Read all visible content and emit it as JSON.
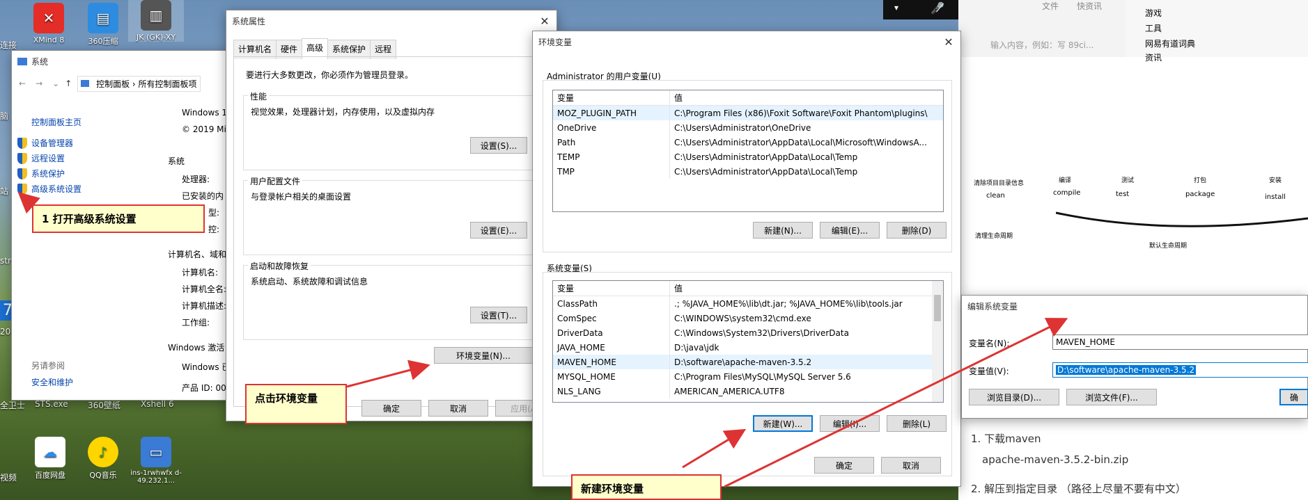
{
  "desktop": {
    "icons": [
      {
        "label": "XMind 8",
        "color": "#e52d27"
      },
      {
        "label": "360压缩",
        "color": "#2d8ce0"
      },
      {
        "label": "JK (GK)-XY",
        "color": "#555555"
      },
      {
        "label": "STS.exe",
        "color": "#3a7"
      },
      {
        "label": "360壁纸",
        "color": "#e63"
      },
      {
        "label": "Xshell 6",
        "color": "#c33"
      },
      {
        "label": "百度网盘",
        "color": "#2a8cf0"
      },
      {
        "label": "QQ音乐",
        "color": "#ffd500"
      },
      {
        "label": "ins-1rwhwfx d-49.232.1...",
        "color": "#3a7bd5"
      }
    ],
    "edge_labels": [
      "连接",
      "脑",
      "站",
      "stra",
      "7",
      "201",
      "全卫士",
      "视频"
    ]
  },
  "system_window": {
    "title": "系统",
    "breadcrumb": [
      "控制面板",
      "所有控制面板项"
    ],
    "nav_home": "控制面板主页",
    "nav_items": [
      "设备管理器",
      "远程设置",
      "系统保护",
      "高级系统设置"
    ],
    "see_also": "另请参阅",
    "security": "安全和维护",
    "windows_edition": "Windows 1",
    "copyright": "© 2019 Mi",
    "section_system": "系统",
    "processor": "处理器:",
    "ram": "已安装的内",
    "sys_type": "型:",
    "pen": "控:",
    "section_name": "计算机名、域和",
    "comp_name": "计算机名:",
    "comp_full": "计算机全名:",
    "comp_desc": "计算机描述:",
    "workgroup": "工作组:",
    "section_activation": "Windows 激活",
    "activation_text": "Windows 已",
    "product_id": "产品 ID: 00"
  },
  "sysprops": {
    "title": "系统属性",
    "tabs": [
      "计算机名",
      "硬件",
      "高级",
      "系统保护",
      "远程"
    ],
    "admin_note": "要进行大多数更改，你必须作为管理员登录。",
    "perf_title": "性能",
    "perf_desc": "视觉效果，处理器计划，内存使用，以及虚拟内存",
    "perf_btn": "设置(S)...",
    "profile_title": "用户配置文件",
    "profile_desc": "与登录帐户相关的桌面设置",
    "profile_btn": "设置(E)...",
    "startup_title": "启动和故障恢复",
    "startup_desc": "系统启动、系统故障和调试信息",
    "startup_btn": "设置(T)...",
    "env_btn": "环境变量(N)...",
    "ok": "确定",
    "cancel": "取消",
    "apply": "应用(A)"
  },
  "envvars": {
    "title": "环境变量",
    "user_section": "Administrator 的用户变量(U)",
    "col_var": "变量",
    "col_val": "值",
    "user_vars": [
      {
        "name": "MOZ_PLUGIN_PATH",
        "value": "C:\\Program Files (x86)\\Foxit Software\\Foxit Phantom\\plugins\\"
      },
      {
        "name": "OneDrive",
        "value": "C:\\Users\\Administrator\\OneDrive"
      },
      {
        "name": "Path",
        "value": "C:\\Users\\Administrator\\AppData\\Local\\Microsoft\\WindowsA..."
      },
      {
        "name": "TEMP",
        "value": "C:\\Users\\Administrator\\AppData\\Local\\Temp"
      },
      {
        "name": "TMP",
        "value": "C:\\Users\\Administrator\\AppData\\Local\\Temp"
      }
    ],
    "user_new": "新建(N)...",
    "user_edit": "编辑(E)...",
    "user_delete": "删除(D)",
    "sys_section": "系统变量(S)",
    "sys_vars": [
      {
        "name": "ClassPath",
        "value": ".;  %JAVA_HOME%\\lib\\dt.jar;  %JAVA_HOME%\\lib\\tools.jar"
      },
      {
        "name": "ComSpec",
        "value": "C:\\WINDOWS\\system32\\cmd.exe"
      },
      {
        "name": "DriverData",
        "value": "C:\\Windows\\System32\\Drivers\\DriverData"
      },
      {
        "name": "JAVA_HOME",
        "value": "D:\\java\\jdk"
      },
      {
        "name": "MAVEN_HOME",
        "value": "D:\\software\\apache-maven-3.5.2"
      },
      {
        "name": "MYSQL_HOME",
        "value": "C:\\Program Files\\MySQL\\MySQL Server 5.6"
      },
      {
        "name": "NLS_LANG",
        "value": "AMERICAN_AMERICA.UTF8"
      }
    ],
    "sys_new": "新建(W)...",
    "sys_edit": "编辑(I)...",
    "sys_delete": "删除(L)",
    "ok": "确定",
    "cancel": "取消"
  },
  "edit_dialog": {
    "title": "编辑系统变量",
    "name_label": "变量名(N):",
    "name_value": "MAVEN_HOME",
    "value_label": "变量值(V):",
    "value_value": "D:\\software\\apache-maven-3.5.2",
    "browse_dir": "浏览目录(D)...",
    "browse_file": "浏览文件(F)...",
    "ok_partial": "确"
  },
  "callouts": {
    "step1": "1 打开高级系统设置",
    "step2": "点击环境变量",
    "step3": "新建环境变量"
  },
  "doc": {
    "top_tabs": [
      "文件",
      "快资讯"
    ],
    "search_placeholder": "输入内容，例如：写 89ci...",
    "side_items": [
      "游戏",
      "工具",
      "网易有道词典",
      "资讯"
    ],
    "lifecycle_labels": [
      "清除项目目录信息",
      "编译",
      "测试",
      "打包",
      "安装"
    ],
    "lifecycle_cmds": [
      "clean",
      "compile",
      "test",
      "package",
      "install"
    ],
    "clean_life": "清理生命周期",
    "default_life": "默认生命周期",
    "step1": "1. 下载maven",
    "zip": "apache-maven-3.5.2-bin.zip",
    "step2": "2. 解压到指定目录 （路径上尽量不要有中文）"
  }
}
